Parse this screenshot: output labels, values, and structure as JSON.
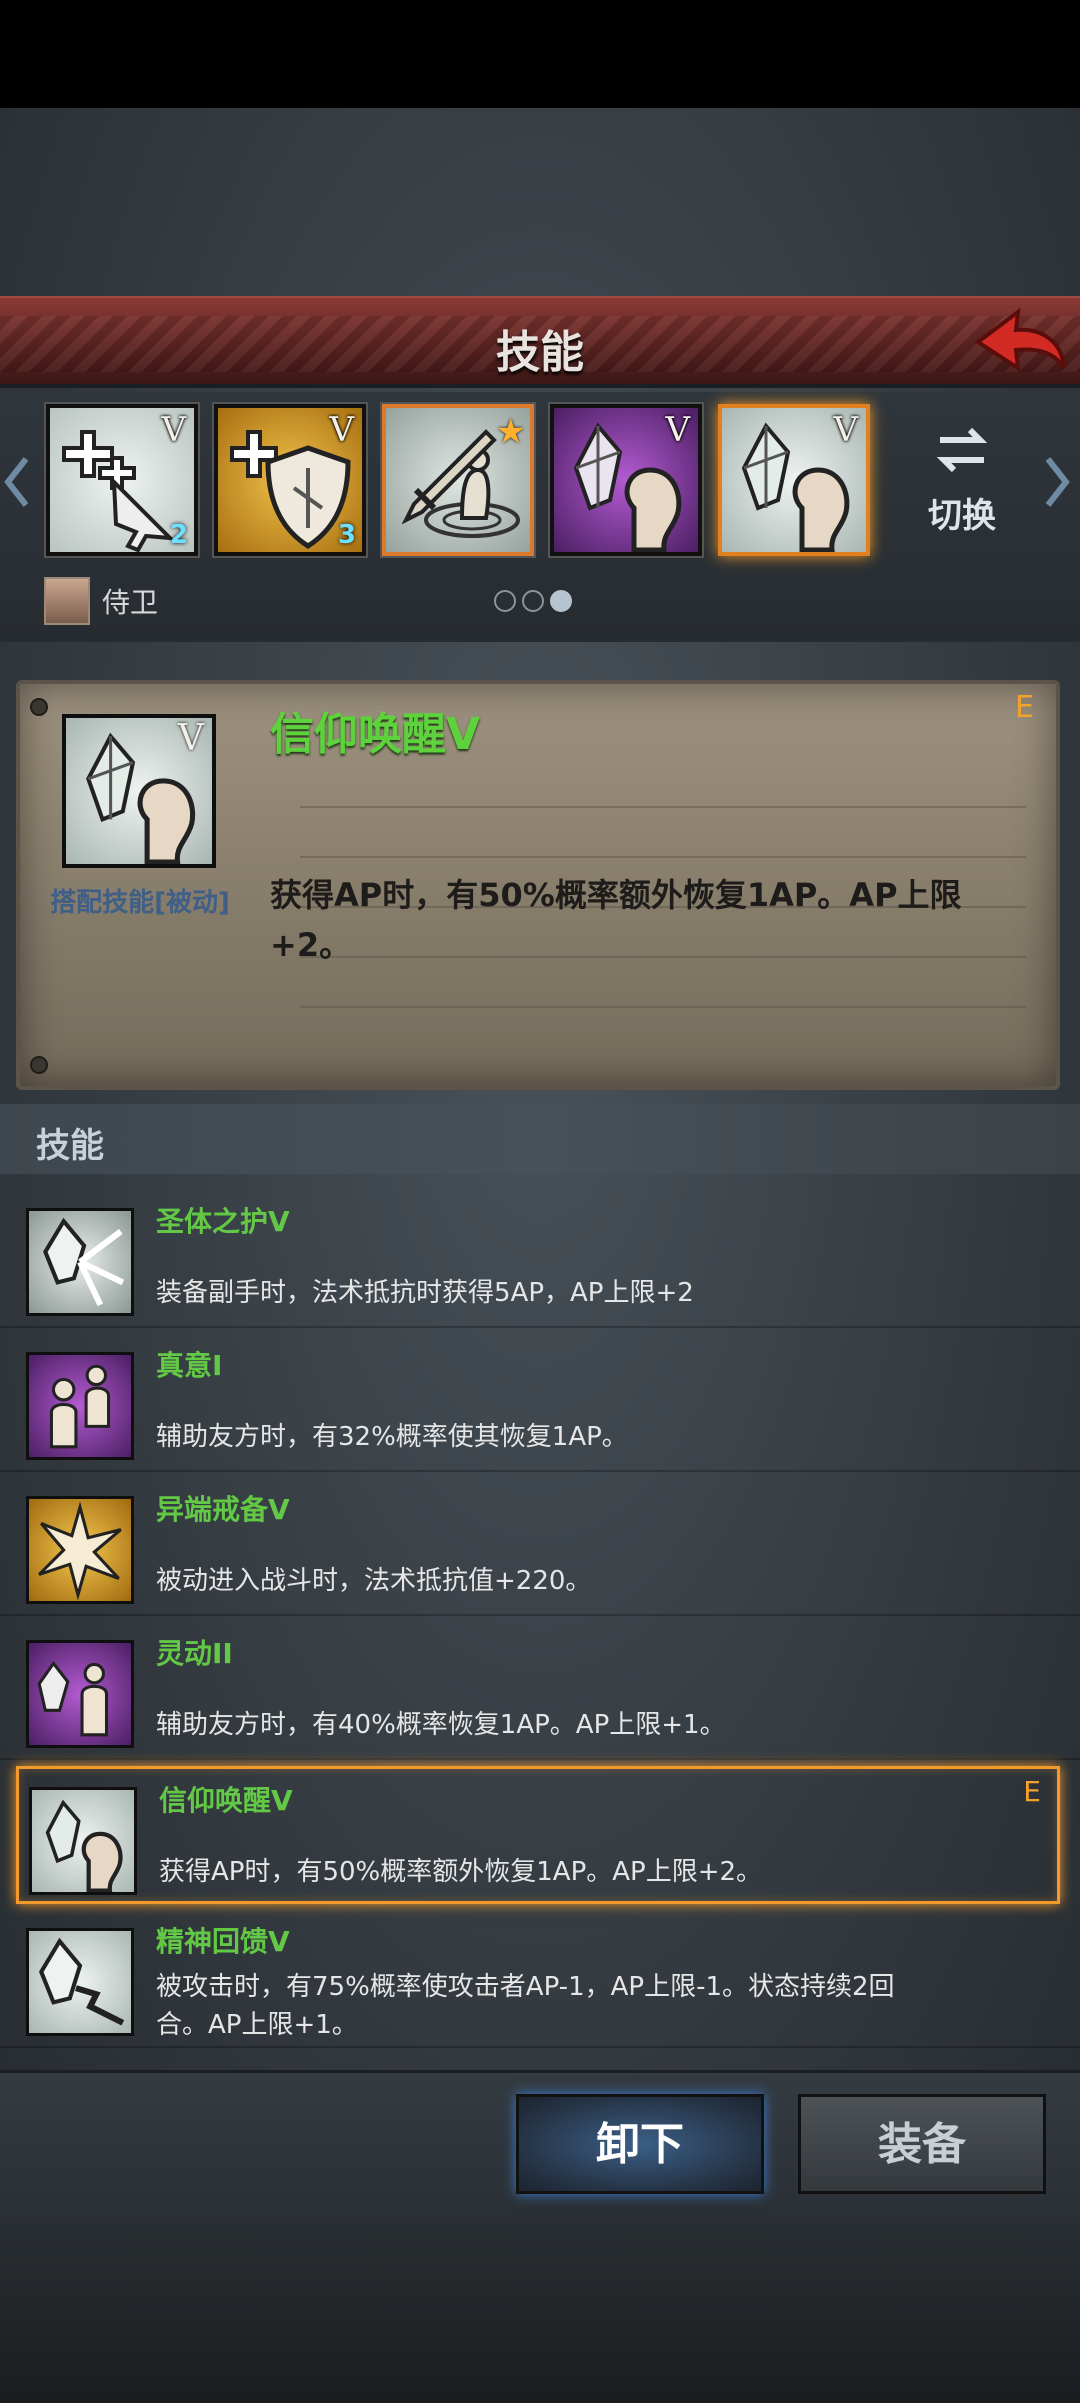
{
  "header": {
    "title": "技能"
  },
  "slots": [
    {
      "tier": "V",
      "badge": "2",
      "kind": "heal"
    },
    {
      "tier": "V",
      "badge": "3",
      "kind": "shield"
    },
    {
      "tier": "",
      "badge": "★",
      "kind": "sword"
    },
    {
      "tier": "V",
      "badge": "",
      "kind": "crystal-purple"
    },
    {
      "tier": "V",
      "badge": "",
      "kind": "crystal"
    }
  ],
  "switch": {
    "label": "切换"
  },
  "hero": {
    "name": "侍卫"
  },
  "detail": {
    "name": "信仰唤醒V",
    "tier": "V",
    "grade": "E",
    "type_label": "搭配技能[被动]",
    "description": "获得AP时，有50%概率额外恢复1AP。AP上限+2。"
  },
  "list": {
    "header": "技能",
    "items": [
      {
        "name": "圣体之护V",
        "desc": "装备副手时，法术抵抗时获得5AP，AP上限+2",
        "grade": ""
      },
      {
        "name": "真意I",
        "desc": "辅助友方时，有32%概率使其恢复1AP。",
        "grade": ""
      },
      {
        "name": "异端戒备V",
        "desc": "被动进入战斗时，法术抵抗值+220。",
        "grade": ""
      },
      {
        "name": "灵动II",
        "desc": "辅助友方时，有40%概率恢复1AP。AP上限+1。",
        "grade": ""
      },
      {
        "name": "信仰唤醒V",
        "desc": "获得AP时，有50%概率额外恢复1AP。AP上限+2。",
        "grade": "E"
      },
      {
        "name": "精神回馈V",
        "desc": "被攻击时，有75%概率使攻击者AP-1，AP上限-1。状态持续2回合。AP上限+1。",
        "grade": ""
      }
    ]
  },
  "buttons": {
    "unequip": "卸下",
    "equip": "装备"
  },
  "colors": {
    "accent_orange": "#f39a2c",
    "skill_green": "#62c845",
    "header_red": "#5c2421"
  }
}
